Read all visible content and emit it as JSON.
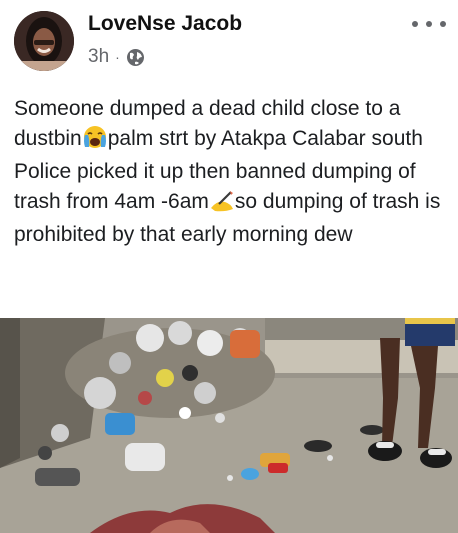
{
  "post": {
    "author": "LoveNse Jacob",
    "time": "3h",
    "separator": "·",
    "audience_icon": "globe-icon",
    "more_icon": "more-options-icon",
    "text": {
      "line1_a": "Someone dumped a dead child close to a dustbin",
      "line1_emoji": "crying-face-emoji",
      "line1_b": "palm strt by Atakpa Calabar south",
      "line2_a": "Police picked it up then banned dumping of trash from 4am -6am",
      "line2_emoji": "writing-hand-emoji",
      "line2_b": "so dumping of trash is prohibited by that early morning dew"
    },
    "photo": {
      "description_icon": "photo"
    }
  },
  "colors": {
    "text": "#1c1e21",
    "meta": "#65676b",
    "emoji_yellow": "#f7c325",
    "tear_blue": "#4aa3df"
  }
}
